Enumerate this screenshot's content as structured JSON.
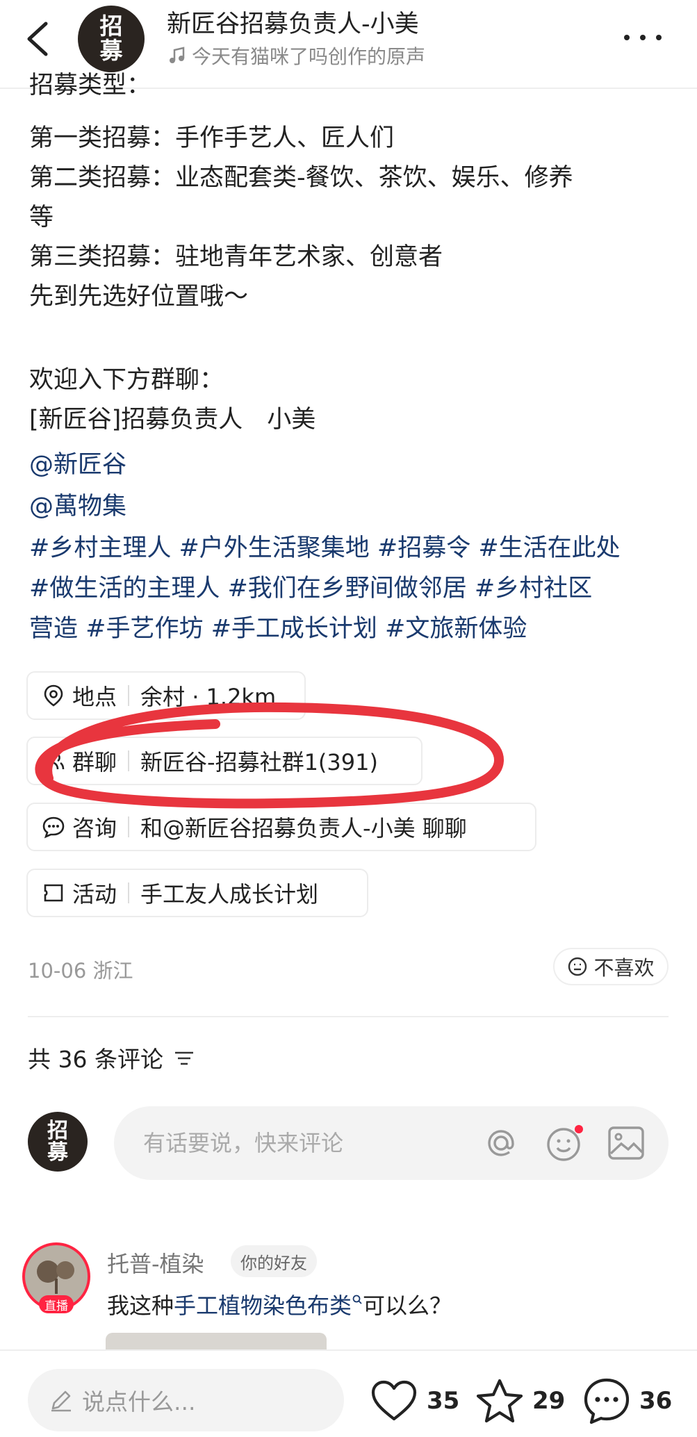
{
  "header": {
    "author_name": "新匠谷招募负责人-小美",
    "avatar_text": "招\n募",
    "music": "今天有猫咪了吗创作的原声"
  },
  "post": {
    "lines": [
      "招募类型：",
      "第一类招募：手作手艺人、匠人们",
      "第二类招募：业态配套类-餐饮、茶饮、娱乐、修养",
      "等",
      "第三类招募：驻地青年艺术家、创意者",
      "先到先选好位置哦～",
      "欢迎入下方群聊：",
      "[新匠谷]招募负责人　小美"
    ],
    "mentions": [
      "@新匠谷",
      "@萬物集"
    ],
    "hashtag_lines": [
      "#乡村主理人 #户外生活聚集地 #招募令 #生活在此处",
      "#做生活的主理人 #我们在乡野间做邻居 #乡村社区",
      "营造 #手艺作坊 #手工成长计划 #文旅新体验"
    ]
  },
  "chips": [
    {
      "label": "地点",
      "value": "余村 · 1.2km"
    },
    {
      "label": "群聊",
      "value": "新匠谷-招募社群1(391)"
    },
    {
      "label": "咨询",
      "value": "和@新匠谷招募负责人-小美 聊聊"
    },
    {
      "label": "活动",
      "value": "手工友人成长计划"
    }
  ],
  "meta": {
    "date_location": "10-06 浙江",
    "dislike_label": "不喜欢"
  },
  "comments_header": {
    "count_text": "共 36 条评论"
  },
  "comment_input": {
    "placeholder": "有话要说，快来评论"
  },
  "comment": {
    "user": "托普-植染",
    "badge": "你的好友",
    "live_badge": "直播",
    "text_prefix": "我这种 ",
    "text_link": "手工植物染色布类",
    "text_suffix": " 可以么？"
  },
  "bottom_bar": {
    "input_placeholder": "说点什么...",
    "likes": "35",
    "stars": "29",
    "comments": "36"
  },
  "colors": {
    "link": "#1a3a6e",
    "annotation": "#e8353e",
    "dot": "#ff2442"
  }
}
